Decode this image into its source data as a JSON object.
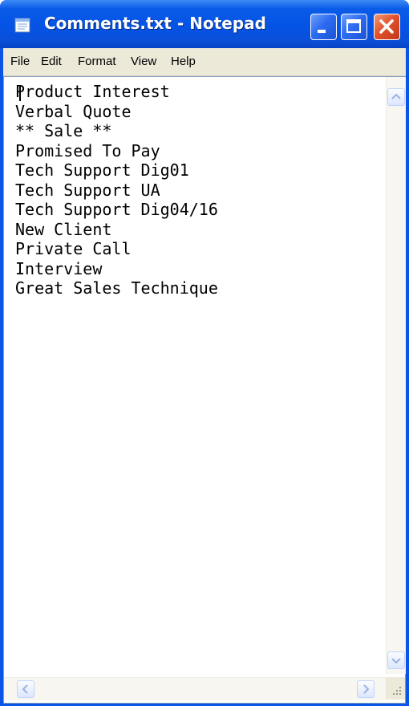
{
  "window": {
    "title": "Comments.txt - Notepad"
  },
  "menu": {
    "file": "File",
    "edit": "Edit",
    "format": "Format",
    "view": "View",
    "help": "Help"
  },
  "document": {
    "lines": [
      "Product Interest",
      "Verbal Quote",
      "** Sale **",
      "Promised To Pay",
      "Tech Support Dig01",
      "Tech Support UA",
      "Tech Support Dig04/16",
      "New Client",
      "Private Call",
      "Interview",
      "Great Sales Technique"
    ]
  },
  "icons": {
    "app": "notepad-icon",
    "minimize": "minimize-icon",
    "maximize": "maximize-icon",
    "close": "close-icon",
    "scroll_up": "chevron-up-icon",
    "scroll_down": "chevron-down-icon",
    "scroll_left": "chevron-left-icon",
    "scroll_right": "chevron-right-icon",
    "resize": "resize-grip-icon"
  },
  "colors": {
    "titlebar": "#0553e6",
    "close_button": "#e2532c",
    "menubar": "#ece9d8",
    "editor_background": "#ffffff"
  }
}
